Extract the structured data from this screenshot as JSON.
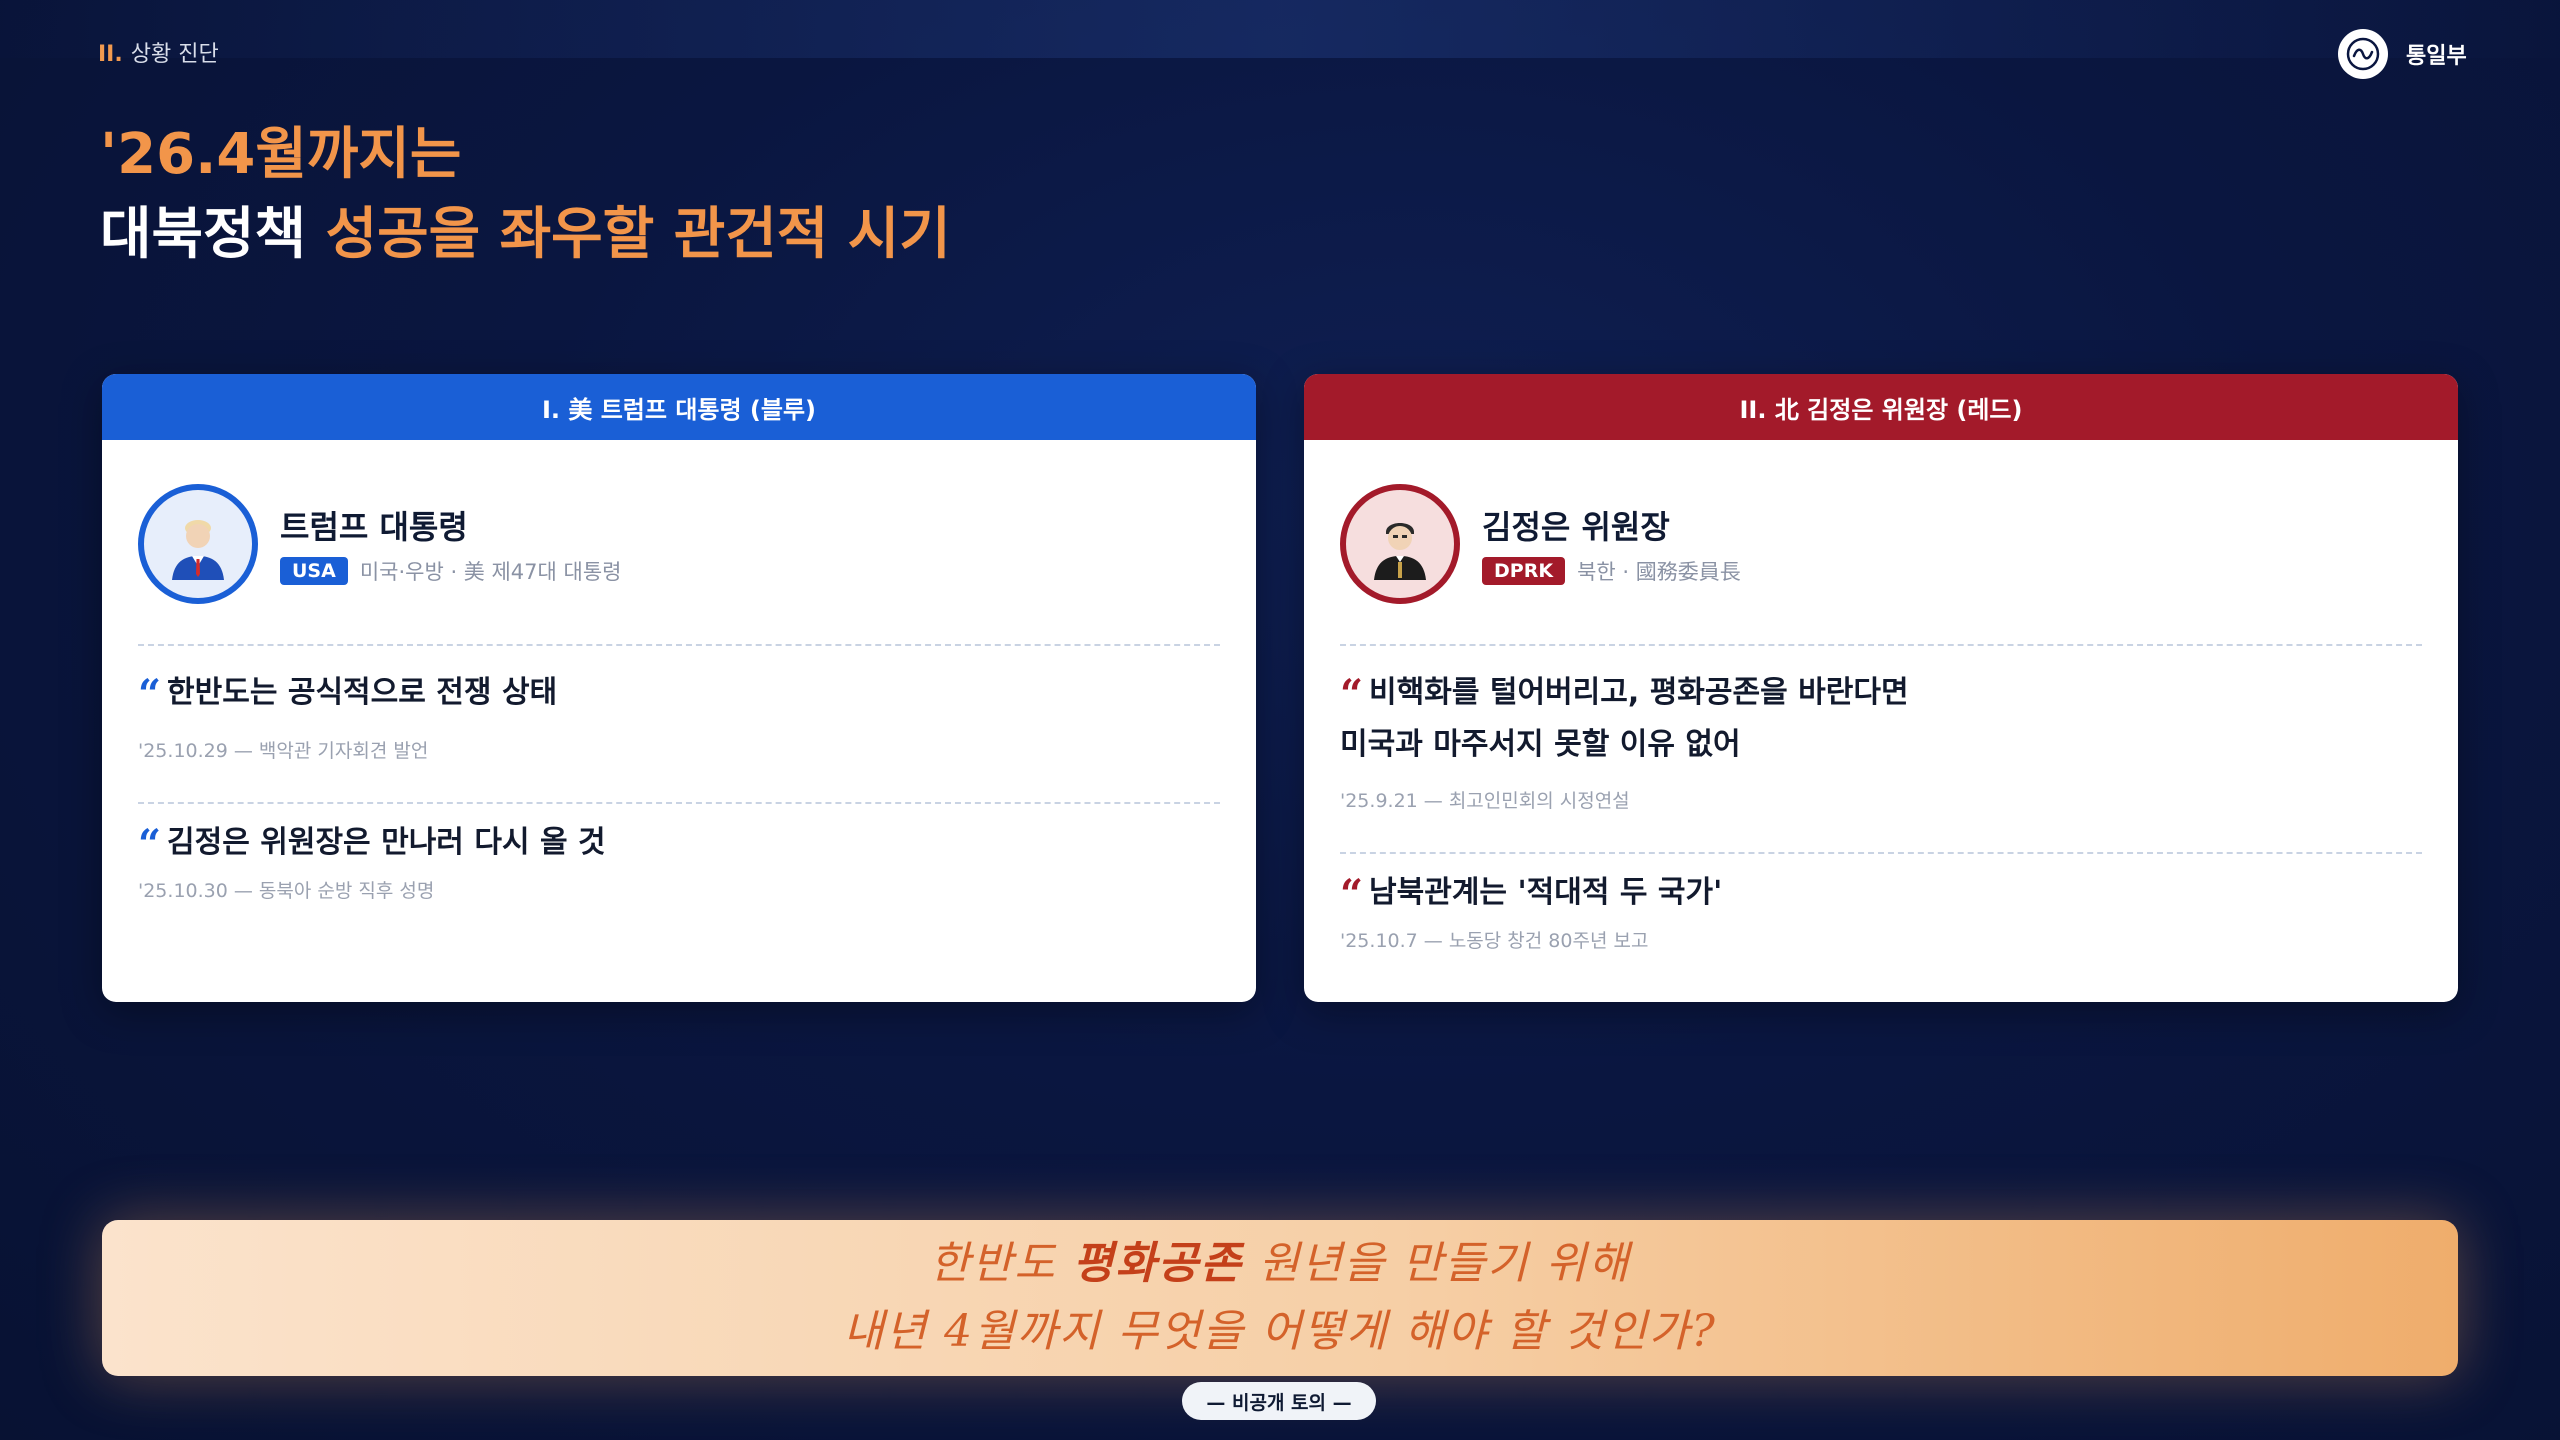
{
  "header": {
    "section_num": "II.",
    "section_label": "상황 진단",
    "ministry_name": "통일부"
  },
  "title": {
    "line1": "'26.4월까지는",
    "line2_prefix": "대북정책 ",
    "line2_accent": "성공을 좌우할 관건적 시기"
  },
  "cards": [
    {
      "header": "I. 美 트럼프 대통령 (블루)",
      "name": "트럼프 대통령",
      "tag": "USA",
      "sub": "미국·우방 · 美 제47대 대통령",
      "avatar_icon": "trump-avatar-icon",
      "quotes": [
        {
          "lines": [
            "한반도는 공식적으로 전쟁 상태"
          ],
          "source": "'25.10.29 — 백악관 기자회견 발언"
        },
        {
          "lines": [
            "김정은 위원장은 만나러 다시 올 것"
          ],
          "source": "'25.10.30 — 동북아 순방 직후 성명"
        }
      ]
    },
    {
      "header": "II. 北 김정은 위원장 (레드)",
      "name": "김정은 위원장",
      "tag": "DPRK",
      "sub": "북한 · 國務委員長",
      "avatar_icon": "kim-avatar-icon",
      "quotes": [
        {
          "lines": [
            "비핵화를 털어버리고, 평화공존을 바란다면",
            "미국과 마주서지 못할 이유 없어"
          ],
          "source": "'25.9.21 — 최고인민회의 시정연설"
        },
        {
          "lines": [
            "남북관계는 '적대적 두 국가'"
          ],
          "source": "'25.10.7 — 노동당 창건 80주년 보고"
        }
      ]
    }
  ],
  "banner": {
    "line1_a": "한반도 ",
    "line1_b": "평화공존",
    "line1_c": " 원년을 만들기 위해",
    "line2": "내년 4월까지 무엇을 어떻게 해야 할 것인가?"
  },
  "pill_label": "— 비공개 토의 —",
  "colors": {
    "accent_orange": "#f2954a",
    "blue": "#1a5fd6",
    "red": "#a31a2a",
    "navy_bg": "#0a1640"
  }
}
